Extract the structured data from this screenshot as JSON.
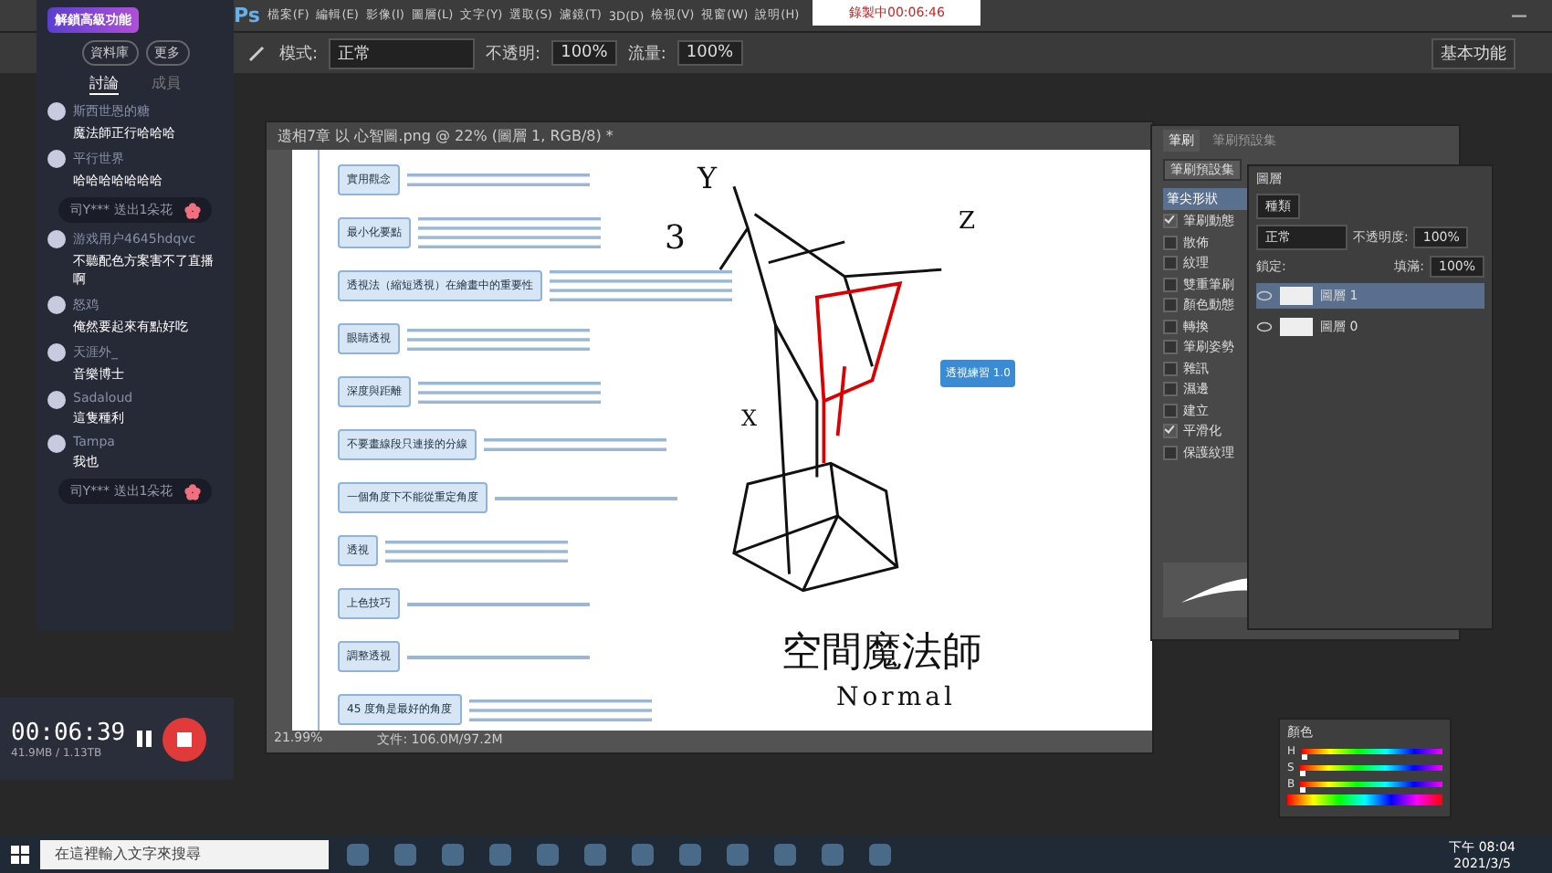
{
  "recording_badge": {
    "text": "錄製中00:06:46"
  },
  "photoshop": {
    "logo": "Ps",
    "menu": [
      "檔案(F)",
      "編輯(E)",
      "影像(I)",
      "圖層(L)",
      "文字(Y)",
      "選取(S)",
      "濾鏡(T)",
      "3D(D)",
      "檢視(V)",
      "視窗(W)",
      "說明(H)"
    ],
    "options": {
      "mode_label": "模式:",
      "mode": "正常",
      "opacity_label": "不透明:",
      "opacity": "100%",
      "flow_label": "流量:",
      "flow": "100%"
    },
    "workspace": "基本功能",
    "document": {
      "title": "遗相7章 以 心智圖.png @ 22% (圖層 1, RGB/8) *",
      "zoom": "21.99%",
      "file_info": "文件: 106.0M/97.2M",
      "nodes": [
        {
          "label": "實用觀念"
        },
        {
          "label": "最小化要點"
        },
        {
          "label": "透視法（縮短透視）在繪畫中的重要性"
        },
        {
          "label": "眼睛透視"
        },
        {
          "label": "深度與距離"
        },
        {
          "label": "不要畫線段只連接的分線"
        },
        {
          "label": "一個角度下不能從重定角度"
        },
        {
          "label": "透視"
        },
        {
          "label": "上色技巧"
        },
        {
          "label": "調整透視"
        },
        {
          "label": "45 度角是最好的角度"
        }
      ],
      "center_node": "透視練習 1.0",
      "sketch": {
        "labels": [
          "Y",
          "3",
          "Z",
          "X"
        ],
        "caption": "空間魔法師",
        "subcaption": "Normal"
      }
    }
  },
  "brush_panel": {
    "tabs": [
      {
        "label": "筆刷",
        "selected": true
      },
      {
        "label": "筆刷預設集",
        "selected": false
      }
    ],
    "preset_button": "筆刷預設集",
    "header": "筆尖形狀",
    "options": [
      {
        "label": "筆刷動態",
        "checked": true
      },
      {
        "label": "散佈",
        "checked": false
      },
      {
        "label": "紋理",
        "checked": false
      },
      {
        "label": "雙重筆刷",
        "checked": false
      },
      {
        "label": "顏色動態",
        "checked": false
      },
      {
        "label": "轉換",
        "checked": false
      },
      {
        "label": "筆刷姿勢",
        "checked": false
      },
      {
        "label": "雜訊",
        "checked": false
      },
      {
        "label": "濕邊",
        "checked": false
      },
      {
        "label": "建立",
        "checked": false
      },
      {
        "label": "平滑化",
        "checked": true
      },
      {
        "label": "保護紋理",
        "checked": false
      }
    ]
  },
  "layers_panel": {
    "title": "圖層",
    "filter": "種類",
    "blend": "正常",
    "opacity_label": "不透明度:",
    "opacity": "100%",
    "lock_label": "鎖定:",
    "fill_label": "填滿:",
    "fill": "100%",
    "layers": [
      {
        "name": "圖層 1",
        "selected": true
      },
      {
        "name": "圖層 0",
        "selected": false
      }
    ]
  },
  "color_panel": {
    "title": "顏色",
    "channels": [
      {
        "label": "H",
        "level": 0.0
      },
      {
        "label": "S",
        "level": 0.0
      },
      {
        "label": "B",
        "level": 0.0
      }
    ]
  },
  "chat": {
    "badge": "解鎖高級功能",
    "buttons": [
      "資料庫",
      "更多"
    ],
    "tabs": [
      {
        "label": "討論",
        "selected": true
      },
      {
        "label": "成員",
        "selected": false
      }
    ],
    "messages": [
      {
        "kind": "user",
        "user": "斯西世恩的糖",
        "text": "魔法師正行哈哈哈"
      },
      {
        "kind": "user",
        "user": "平行世界",
        "text": "哈哈哈哈哈哈哈"
      },
      {
        "kind": "gift",
        "text": "司Y*** 送出1朵花"
      },
      {
        "kind": "user",
        "user": "游戏用户4645hdqvc",
        "text": "不聽配色方案害不了直播啊"
      },
      {
        "kind": "user",
        "user": "怒鸡",
        "text": "俺然要起來有點好吃"
      },
      {
        "kind": "user",
        "user": "天涯外_",
        "text": "音樂博士"
      },
      {
        "kind": "user",
        "user": "Sadaloud",
        "text": "這隻種利"
      },
      {
        "kind": "user",
        "user": "Tampa",
        "text": "我也"
      },
      {
        "kind": "gift",
        "text": "司Y*** 送出1朵花"
      }
    ]
  },
  "recorder": {
    "time": "00:06:39",
    "size": "41.9MB / 1.13TB"
  },
  "taskbar": {
    "search_placeholder": "在這裡輸入文字來搜尋",
    "time": "下午 08:04",
    "date": "2021/3/5"
  }
}
